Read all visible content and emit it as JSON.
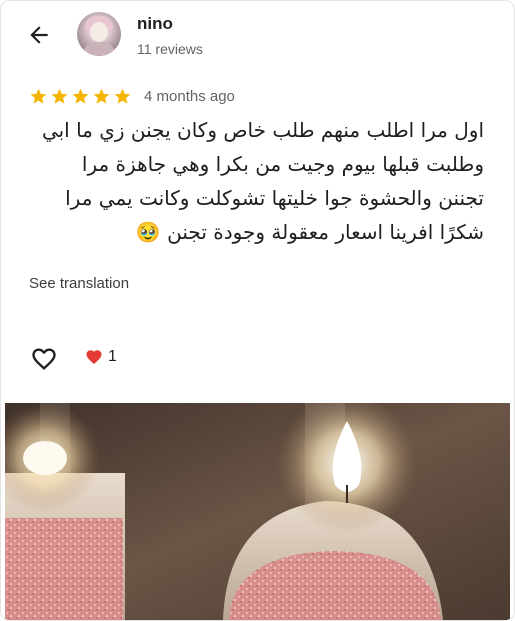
{
  "reviewer": {
    "name": "nino",
    "reviews": "11 reviews"
  },
  "review": {
    "rating": 5,
    "max_rating": 5,
    "time_ago": "4 months ago",
    "lines": [
      "اول مرا اطلب منهم طلب خاص وكان يجنن زي ما ابي",
      "وطلبت قبلها بيوم وجيت من بكرا وهي جاهزة مرا",
      "تجننن والحشوة جوا خليتها تشوكلت وكانت يمي مرا",
      "شكرًا افرينا اسعار معقولة وجودة تجنن 🥹"
    ],
    "see_translation": "See translation"
  },
  "reactions": {
    "heart_count": "1"
  },
  "colors": {
    "star": "#f4b400",
    "heart_reaction": "#e53935",
    "secondary_text": "#5f6368"
  },
  "icons": {
    "back": "arrow-left-icon",
    "like": "heart-outline-icon",
    "reaction": "red-heart-icon"
  }
}
